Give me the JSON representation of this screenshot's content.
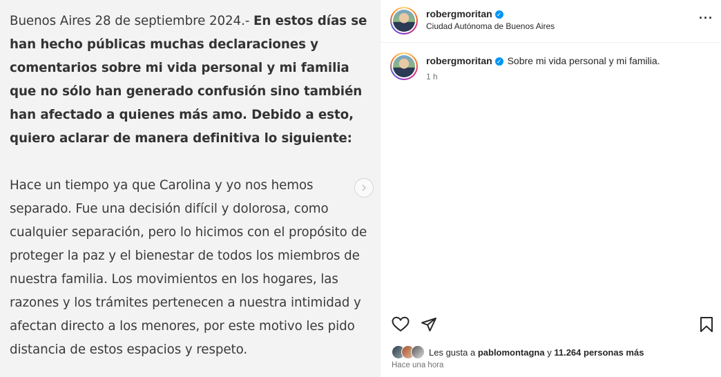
{
  "post": {
    "paragraph1_intro": "Buenos Aires 28 de septiembre 2024.- ",
    "paragraph1_bold": "En estos días se han hecho públicas muchas declaraciones y comentarios sobre mi vida personal y mi familia que no sólo han generado confusión sino también han afectado a quienes más amo. Debido a esto, quiero aclarar de manera definitiva lo siguiente:",
    "paragraph2": "Hace un tiempo ya que Carolina y yo nos hemos separado. Fue una decisión difícil y dolorosa, como cualquier separación, pero lo hicimos con el propósito de proteger la paz y el bienestar de todos los miembros de nuestra familia. Los movimientos en los hogares, las razones y los trámites pertenecen a nuestra intimidad y afectan directo a los menores, por este motivo les pido distancia de estos espacios y respeto."
  },
  "header": {
    "username": "robergmoritan",
    "location": "Ciudad Autónoma de Buenos Aires",
    "more_icon": "more-horizontal-icon"
  },
  "caption": {
    "username": "robergmoritan",
    "text": "Sobre mi vida personal y mi familia.",
    "time": "1 h"
  },
  "likes": {
    "prefix": "Les gusta a ",
    "user": "pablomontagna",
    "middle": " y ",
    "count": "11.264 personas más"
  },
  "timestamp": "Hace una hora",
  "colors": {
    "verified": "#0095f6",
    "secondary_text": "#737373",
    "image_bg": "#f3f3f3"
  }
}
